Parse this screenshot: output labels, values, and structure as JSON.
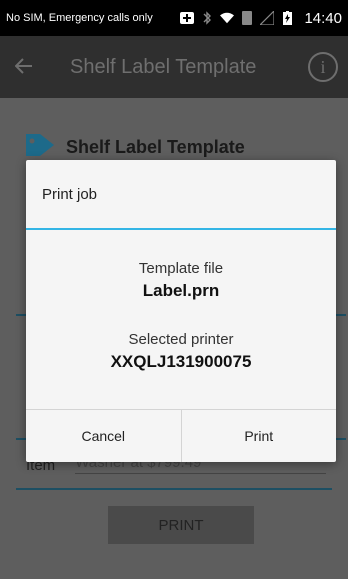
{
  "status_bar": {
    "carrier": "No SIM, Emergency calls only",
    "time": "14:40"
  },
  "app_bar": {
    "title": "Shelf Label Template"
  },
  "content": {
    "heading": "Shelf Label Template",
    "item_label": "Item",
    "item_value": "Washer at $799.49",
    "print_label": "PRINT"
  },
  "dialog": {
    "title": "Print job",
    "template_label": "Template file",
    "template_value": "Label.prn",
    "printer_label": "Selected printer",
    "printer_value": "XXQLJ131900075",
    "cancel_label": "Cancel",
    "print_label": "Print"
  },
  "colors": {
    "accent": "#33b5e5",
    "tag_icon": "#1d6a8a"
  }
}
